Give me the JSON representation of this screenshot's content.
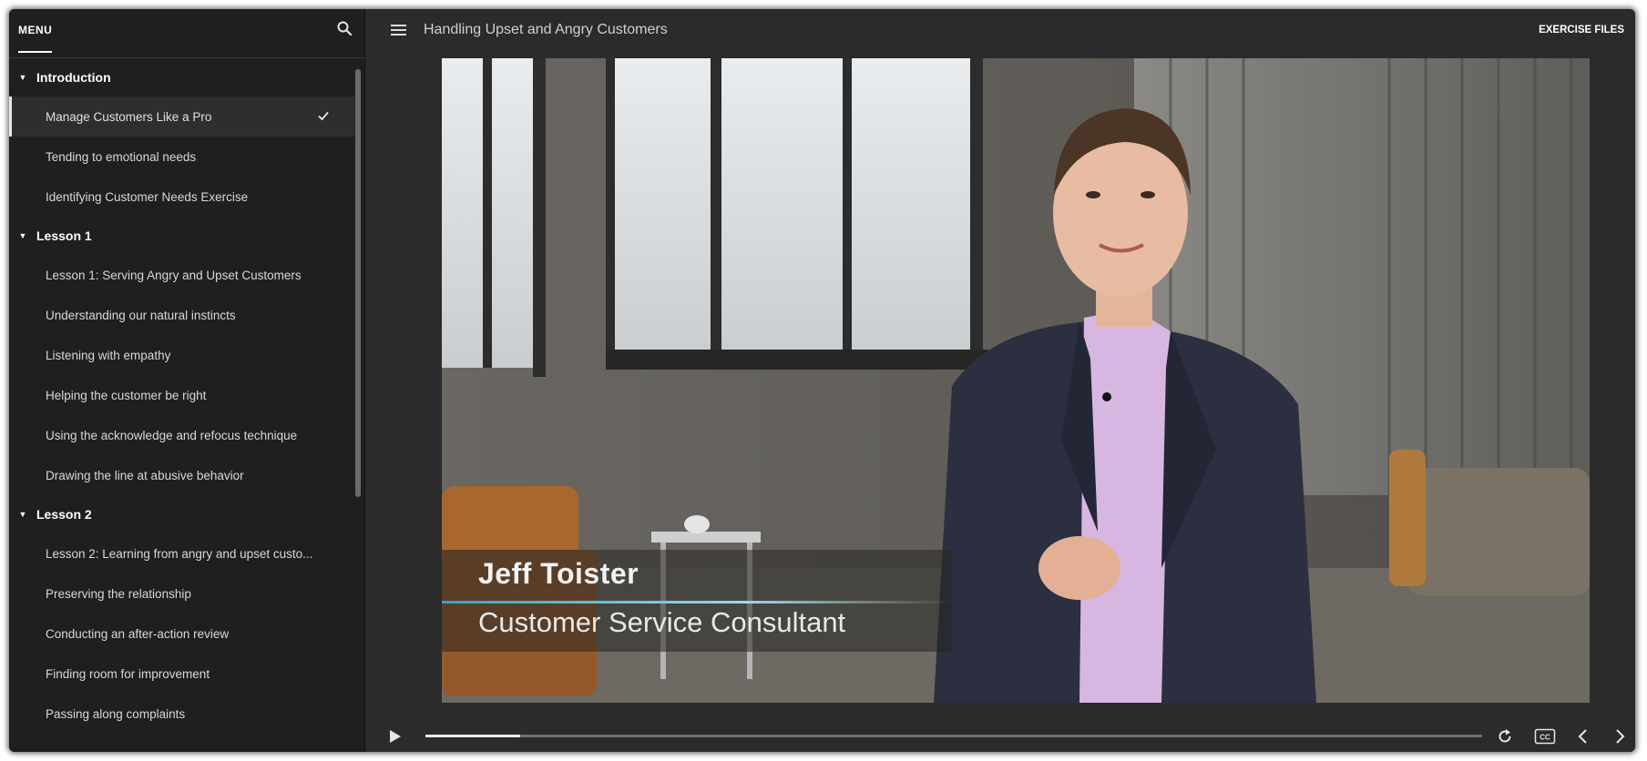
{
  "sidebar": {
    "menu_label": "MENU",
    "search_icon": "search-icon",
    "sections": [
      {
        "title": "Introduction",
        "items": [
          {
            "label": "Manage Customers Like a Pro",
            "active": true,
            "completed": true
          },
          {
            "label": "Tending to emotional needs"
          },
          {
            "label": "Identifying Customer Needs Exercise"
          }
        ]
      },
      {
        "title": "Lesson 1",
        "items": [
          {
            "label": "Lesson 1: Serving Angry and Upset Customers"
          },
          {
            "label": "Understanding our natural instincts"
          },
          {
            "label": "Listening with empathy"
          },
          {
            "label": "Helping the customer be right"
          },
          {
            "label": "Using the acknowledge and refocus technique"
          },
          {
            "label": "Drawing the line at abusive behavior"
          }
        ]
      },
      {
        "title": "Lesson 2",
        "items": [
          {
            "label": "Lesson 2: Learning from angry and upset custo..."
          },
          {
            "label": "Preserving the relationship"
          },
          {
            "label": "Conducting an after-action review"
          },
          {
            "label": "Finding room for improvement"
          },
          {
            "label": "Passing along complaints"
          }
        ]
      }
    ]
  },
  "header": {
    "course_title": "Handling Upset and Angry Customers",
    "exercise_files": "EXERCISE FILES"
  },
  "video": {
    "presenter_name": "Jeff Toister",
    "presenter_role": "Customer Service Consultant",
    "progress_fraction": 0.09
  },
  "controls": {
    "icons": [
      "play-icon",
      "replay-icon",
      "closed-captions-icon",
      "previous-icon",
      "next-icon"
    ]
  },
  "colors": {
    "sidebar_bg": "#1f1f1f",
    "main_bg": "#2b2b2b",
    "accent_line": "#2aa7c4"
  }
}
